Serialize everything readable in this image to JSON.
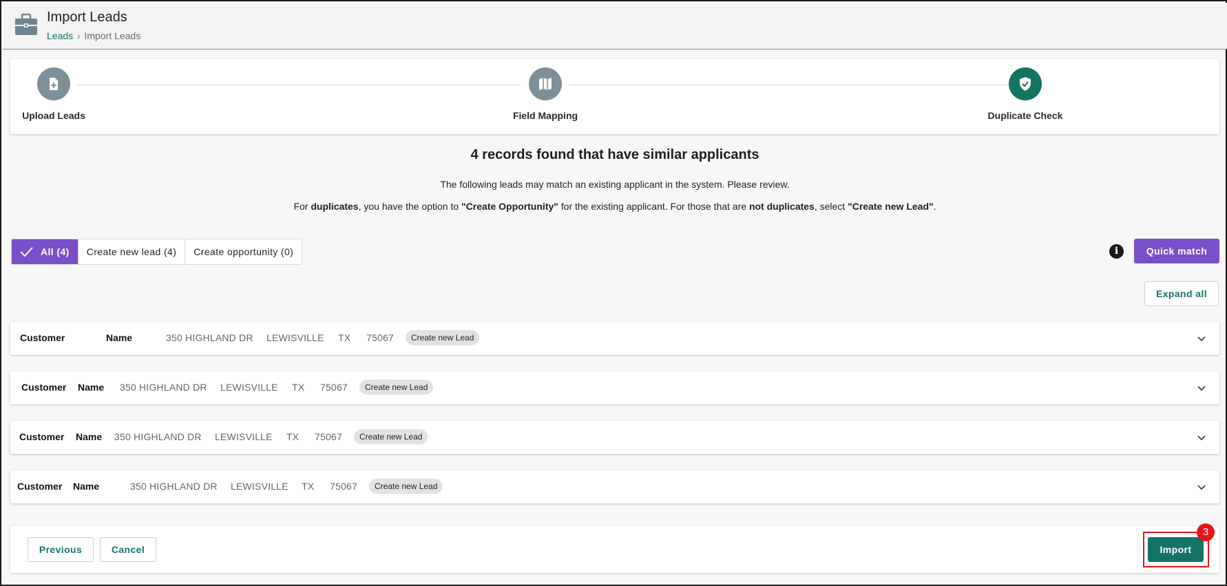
{
  "header": {
    "title": "Import Leads",
    "breadcrumb": {
      "link": "Leads",
      "separator": "›",
      "current": "Import Leads"
    }
  },
  "stepper": {
    "steps": [
      {
        "label": "Upload Leads",
        "state": "done",
        "icon": "file-plus-icon"
      },
      {
        "label": "Field Mapping",
        "state": "done",
        "icon": "map-icon"
      },
      {
        "label": "Duplicate Check",
        "state": "active",
        "icon": "shield-check-icon"
      }
    ]
  },
  "summary": {
    "title": "4 records found that have similar applicants",
    "line1": "The following leads may match an existing applicant in the system. Please review.",
    "line2": {
      "p1": "For ",
      "b1": "duplicates",
      "p2": ", you have the option to ",
      "b2": "\"Create Opportunity\"",
      "p3": " for the existing applicant. For those that are ",
      "b3": "not duplicates",
      "p4": ", select ",
      "b4": "\"Create new Lead\"",
      "p5": "."
    }
  },
  "filters": {
    "all": "All (4)",
    "create_new_lead": "Create new lead (4)",
    "create_opportunity": "Create opportunity (0)"
  },
  "actions": {
    "info_symbol": "i",
    "quick_match": "Quick match",
    "expand_all": "Expand all"
  },
  "records": [
    {
      "first": "Customer",
      "last": "Name",
      "address": "350 HIGHLAND DR",
      "city": "LEWISVILLE",
      "state": "TX",
      "zip": "75067",
      "badge": "Create new Lead"
    },
    {
      "first": "Customer",
      "last": "Name",
      "address": "350 HIGHLAND DR",
      "city": "LEWISVILLE",
      "state": "TX",
      "zip": "75067",
      "badge": "Create new Lead"
    },
    {
      "first": "Customer",
      "last": "Name",
      "address": "350 HIGHLAND DR",
      "city": "LEWISVILLE",
      "state": "TX",
      "zip": "75067",
      "badge": "Create new Lead"
    },
    {
      "first": "Customer",
      "last": "Name",
      "address": "350 HIGHLAND DR",
      "city": "LEWISVILLE",
      "state": "TX",
      "zip": "75067",
      "badge": "Create new Lead"
    }
  ],
  "footer": {
    "previous": "Previous",
    "cancel": "Cancel",
    "import": "Import",
    "annotation_number": "3"
  },
  "colors": {
    "primary_teal": "#137463",
    "accent_purple": "#7a4fc9",
    "highlight_red": "#e0161a",
    "step_done_grey": "#7d8f99"
  }
}
